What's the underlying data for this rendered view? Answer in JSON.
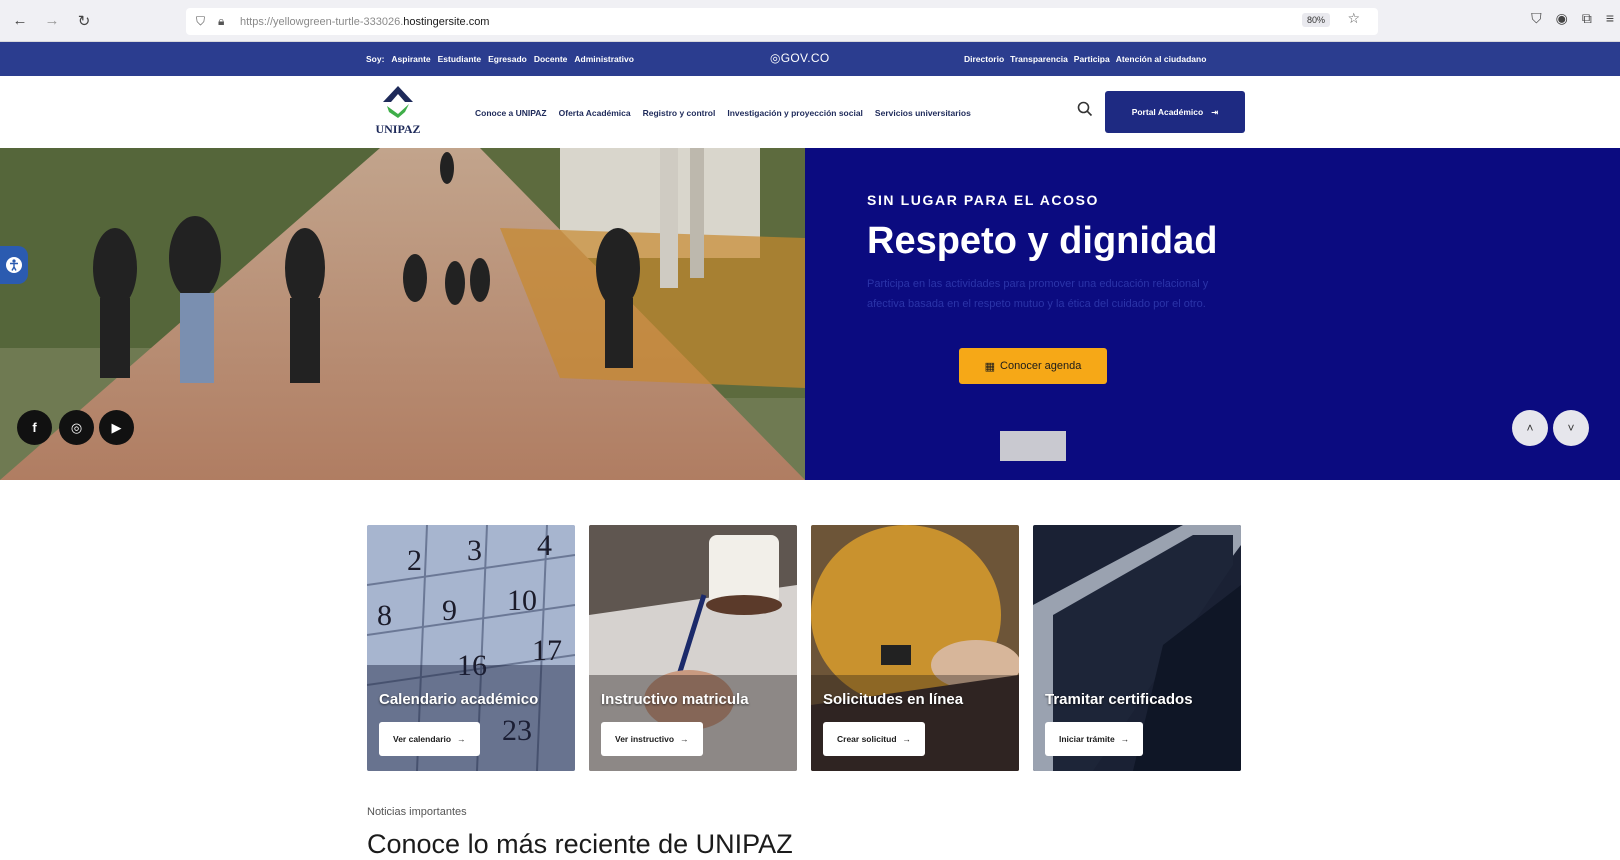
{
  "browser": {
    "url_prefix": "https://yellowgreen-turtle-333026.",
    "url_host": "hostingersite.com",
    "zoom": "80%"
  },
  "govbar": {
    "left_items": [
      "Soy:",
      "Aspirante",
      "Estudiante",
      "Egresado",
      "Docente",
      "Administrativo"
    ],
    "center": "GOV.CO",
    "right_items": [
      "Directorio",
      "Transparencia",
      "Participa",
      "Atención al ciudadano"
    ]
  },
  "header": {
    "logo_text": "UNIPAZ",
    "nav": [
      "Conoce a UNIPAZ",
      "Oferta Académica",
      "Registro y control",
      "Investigación y proyección social",
      "Servicios universitarios"
    ],
    "portal_label": "Portal Académico"
  },
  "hero": {
    "eyebrow": "SIN LUGAR PARA EL ACOSO",
    "title": "Respeto y dignidad",
    "description": "Participa en las actividades para promover una educación relacional y afectiva basada en el respeto mutuo y la ética del cuidado por el otro.",
    "button_label": "Conocer agenda",
    "social": [
      "f",
      "◎",
      "▶"
    ]
  },
  "cards": [
    {
      "title": "Calendario académico",
      "button": "Ver calendario"
    },
    {
      "title": "Instructivo matricula",
      "button": "Ver instructivo"
    },
    {
      "title": "Solicitudes en línea",
      "button": "Crear solicitud"
    },
    {
      "title": "Tramitar certificados",
      "button": "Iniciar trámite"
    }
  ],
  "news": {
    "label": "Noticias importantes",
    "title": "Conoce lo más reciente de UNIPAZ"
  },
  "colors": {
    "gov_blue": "#2b3d8f",
    "hero_blue": "#0b0b80",
    "accent_orange": "#f6a817",
    "portal_blue": "#1e2a82"
  }
}
